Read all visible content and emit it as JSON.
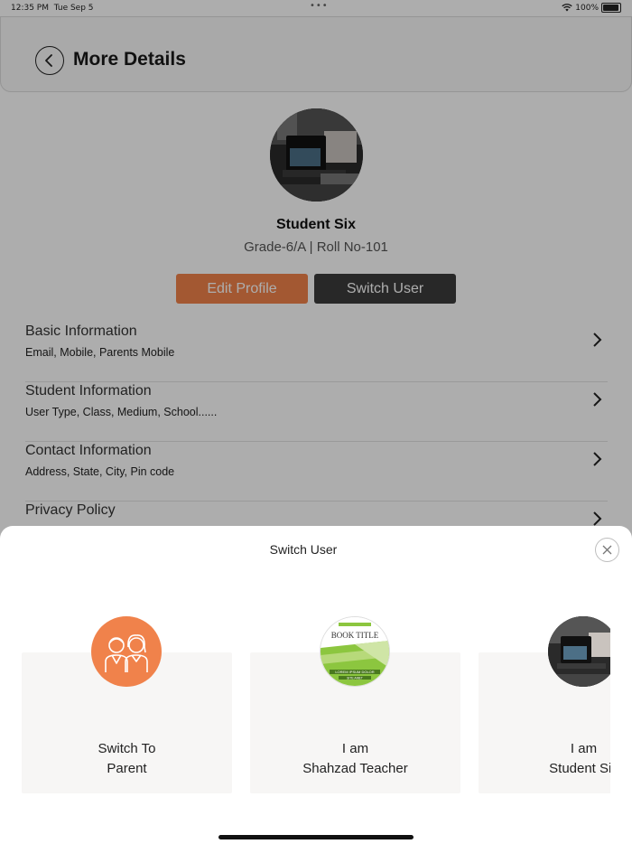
{
  "status_bar": {
    "time": "12:35 PM",
    "date": "Tue Sep 5",
    "battery": "100%"
  },
  "header": {
    "title": "More Details"
  },
  "profile": {
    "name": "Student Six",
    "subtitle": "Grade-6/A | Roll No-101",
    "edit_label": "Edit Profile",
    "switch_label": "Switch User"
  },
  "menu": [
    {
      "title": "Basic Information",
      "desc": "Email, Mobile, Parents Mobile"
    },
    {
      "title": "Student Information",
      "desc": "User Type, Class, Medium, School......"
    },
    {
      "title": "Contact Information",
      "desc": "Address, State, City, Pin code"
    },
    {
      "title": "Privacy Policy",
      "desc": ""
    }
  ],
  "sheet": {
    "title": "Switch User",
    "cards": [
      {
        "line1": "Switch To",
        "line2": "Parent"
      },
      {
        "line1": "I am",
        "line2": "Shahzad Teacher"
      },
      {
        "line1": "I am",
        "line2": "Student Six"
      }
    ]
  },
  "book_cover": {
    "title": "BOOK TITLE",
    "lines": [
      "LOREM IPSUM DOLOR",
      "SITE AMET"
    ]
  },
  "colors": {
    "accent": "#f0824b",
    "dark_button": "#3b3b3b",
    "green": "#8cc63f"
  }
}
